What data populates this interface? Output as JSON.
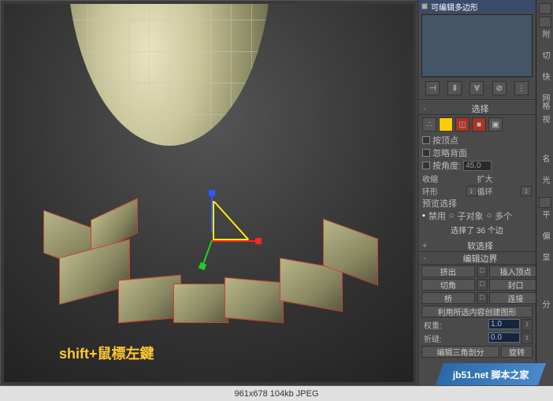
{
  "viewport": {
    "hint": "shift+鼠標左鍵"
  },
  "modifier_stack": {
    "current": "可编辑多边形"
  },
  "selection": {
    "title": "选择",
    "by_vertex": "按顶点",
    "ignore_backfacing": "忽略背面",
    "by_angle": "按角度:",
    "angle_value": "45.0",
    "shrink": "收缩",
    "grow": "扩大",
    "ring": "环形",
    "loop": "循环",
    "preview_title": "预览选择",
    "preview_off": "禁用",
    "preview_subobj": "子对象",
    "preview_multi": "多个",
    "status": "选择了 36 个边"
  },
  "soft_sel": {
    "title": "软选择"
  },
  "edit_edges": {
    "title": "编辑边界",
    "extrude": "挤出",
    "insert_vertex": "插入顶点",
    "chamfer": "切角",
    "cap": "封口",
    "bridge": "桥",
    "connect": "连接",
    "create_shape": "利用所选内容创建图形",
    "weight": "权重:",
    "weight_val": "1.0",
    "crease": "折缝:",
    "crease_val": "0.0",
    "edit_tri": "编辑三角剖分",
    "turn": "旋转"
  },
  "right_tabs": {
    "t1": "附",
    "t2": "切",
    "t3": "快",
    "t4": "网格",
    "t5": "视",
    "sec1": "名",
    "sec2": "光",
    "sec3": "平",
    "sec4": "偏",
    "sec5": "显",
    "sec6": "分"
  },
  "footer": {
    "dims": "961x678 104kb JPEG"
  },
  "watermark": {
    "site": "jb51.net",
    "name": "脚本之家"
  }
}
